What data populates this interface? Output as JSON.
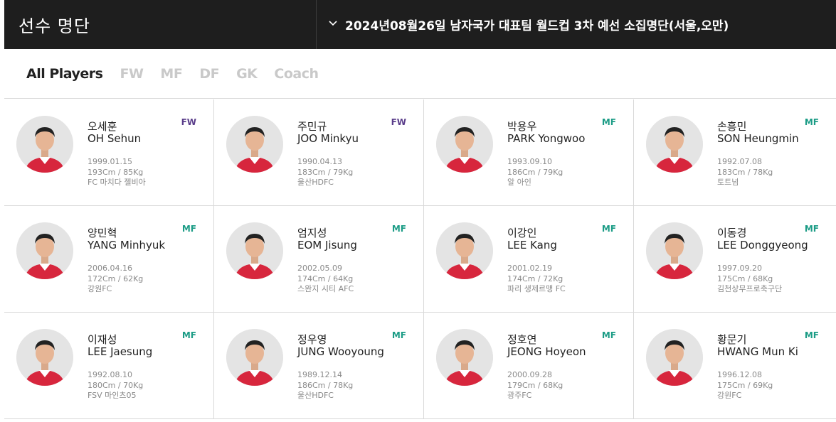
{
  "header": {
    "title": "선수 명단",
    "squad_select": "2024년08월26일 남자국가 대표팀 월드컵 3차 예선 소집명단(서울,오만)"
  },
  "filters": [
    "All Players",
    "FW",
    "MF",
    "DF",
    "GK",
    "Coach"
  ],
  "active_filter": "All Players",
  "colors": {
    "fw": "#5a3d8a",
    "mf": "#1c9c86",
    "header_bg": "#1e1e1e"
  },
  "players": [
    [
      {
        "ko": "오세훈",
        "en": "OH Sehun",
        "pos": "FW",
        "dob": "1999.01.15",
        "body": "193Cm / 85Kg",
        "club": "FC 마치다 젤비아"
      },
      {
        "ko": "주민규",
        "en": "JOO Minkyu",
        "pos": "FW",
        "dob": "1990.04.13",
        "body": "183Cm / 79Kg",
        "club": "울산HDFC"
      },
      {
        "ko": "박용우",
        "en": "PARK Yongwoo",
        "pos": "MF",
        "dob": "1993.09.10",
        "body": "186Cm / 79Kg",
        "club": "알 아인"
      },
      {
        "ko": "손흥민",
        "en": "SON Heungmin",
        "pos": "MF",
        "dob": "1992.07.08",
        "body": "183Cm / 78Kg",
        "club": "토트넘"
      }
    ],
    [
      {
        "ko": "양민혁",
        "en": "YANG Minhyuk",
        "pos": "MF",
        "dob": "2006.04.16",
        "body": "172Cm / 62Kg",
        "club": "강원FC"
      },
      {
        "ko": "엄지성",
        "en": "EOM Jisung",
        "pos": "MF",
        "dob": "2002.05.09",
        "body": "174Cm / 64Kg",
        "club": "스완지 시티 AFC"
      },
      {
        "ko": "이강인",
        "en": "LEE Kang",
        "pos": "MF",
        "dob": "2001.02.19",
        "body": "174Cm / 72Kg",
        "club": "파리 생제르맹 FC"
      },
      {
        "ko": "이동경",
        "en": "LEE Donggyeong",
        "pos": "MF",
        "dob": "1997.09.20",
        "body": "175Cm / 68Kg",
        "club": "김천상무프로축구단"
      }
    ],
    [
      {
        "ko": "이재성",
        "en": "LEE Jaesung",
        "pos": "MF",
        "dob": "1992.08.10",
        "body": "180Cm / 70Kg",
        "club": "FSV 마인츠05"
      },
      {
        "ko": "정우영",
        "en": "JUNG Wooyoung",
        "pos": "MF",
        "dob": "1989.12.14",
        "body": "186Cm / 78Kg",
        "club": "울산HDFC"
      },
      {
        "ko": "정호연",
        "en": "JEONG Hoyeon",
        "pos": "MF",
        "dob": "2000.09.28",
        "body": "179Cm / 68Kg",
        "club": "광주FC"
      },
      {
        "ko": "황문기",
        "en": "HWANG Mun Ki",
        "pos": "MF",
        "dob": "1996.12.08",
        "body": "175Cm / 69Kg",
        "club": "강원FC"
      }
    ]
  ]
}
